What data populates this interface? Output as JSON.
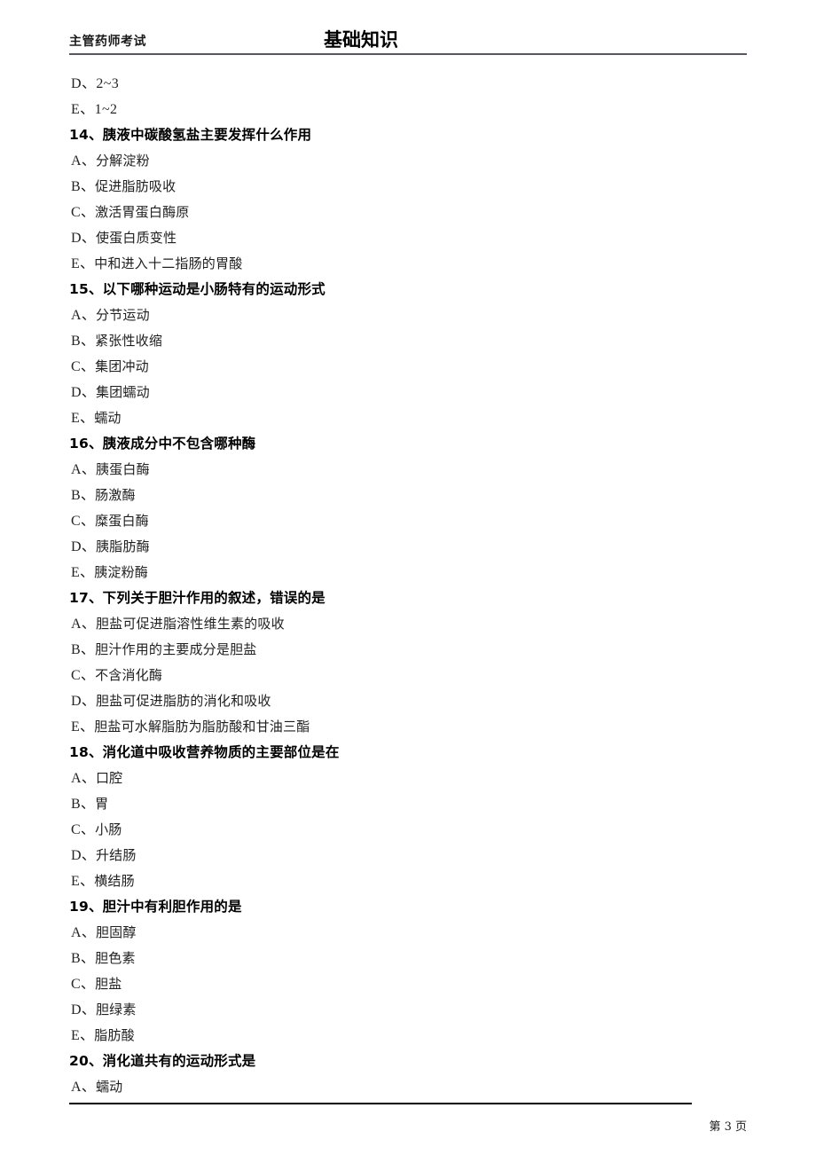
{
  "header": {
    "left_title": "主管药师考试",
    "center_title": "基础知识"
  },
  "footer": {
    "page_label": "第 3 页"
  },
  "content": {
    "leading_options": [
      {
        "letter": "D",
        "sep": "、",
        "text": "2~3"
      },
      {
        "letter": "E",
        "sep": "、",
        "text": "1~2"
      }
    ],
    "questions": [
      {
        "number": "14",
        "sep": "、",
        "title": "胰液中碳酸氢盐主要发挥什么作用",
        "options": [
          {
            "letter": "A",
            "sep": "、",
            "text": "分解淀粉"
          },
          {
            "letter": "B",
            "sep": "、",
            "text": "促进脂肪吸收"
          },
          {
            "letter": "C",
            "sep": "、",
            "text": "激活胃蛋白酶原"
          },
          {
            "letter": "D",
            "sep": "、",
            "text": "使蛋白质变性"
          },
          {
            "letter": "E",
            "sep": "、",
            "text": "中和进入十二指肠的胃酸"
          }
        ]
      },
      {
        "number": "15",
        "sep": "、",
        "title": "以下哪种运动是小肠特有的运动形式",
        "options": [
          {
            "letter": "A",
            "sep": "、",
            "text": "分节运动"
          },
          {
            "letter": "B",
            "sep": "、",
            "text": "紧张性收缩"
          },
          {
            "letter": "C",
            "sep": "、",
            "text": "集团冲动"
          },
          {
            "letter": "D",
            "sep": "、",
            "text": "集团蠕动"
          },
          {
            "letter": "E",
            "sep": "、",
            "text": "蠕动"
          }
        ]
      },
      {
        "number": "16",
        "sep": "、",
        "title": "胰液成分中不包含哪种酶",
        "options": [
          {
            "letter": "A",
            "sep": "、",
            "text": "胰蛋白酶"
          },
          {
            "letter": "B",
            "sep": "、",
            "text": "肠激酶"
          },
          {
            "letter": "C",
            "sep": "、",
            "text": "糜蛋白酶"
          },
          {
            "letter": "D",
            "sep": "、",
            "text": "胰脂肪酶"
          },
          {
            "letter": "E",
            "sep": "、",
            "text": "胰淀粉酶"
          }
        ]
      },
      {
        "number": "17",
        "sep": "、",
        "title": "下列关于胆汁作用的叙述，错误的是",
        "options": [
          {
            "letter": "A",
            "sep": "、",
            "text": "胆盐可促进脂溶性维生素的吸收"
          },
          {
            "letter": "B",
            "sep": "、",
            "text": "胆汁作用的主要成分是胆盐"
          },
          {
            "letter": "C",
            "sep": "、",
            "text": "不含消化酶"
          },
          {
            "letter": "D",
            "sep": "、",
            "text": "胆盐可促进脂肪的消化和吸收"
          },
          {
            "letter": "E",
            "sep": "、",
            "text": "胆盐可水解脂肪为脂肪酸和甘油三酯"
          }
        ]
      },
      {
        "number": "18",
        "sep": "、",
        "title": "消化道中吸收营养物质的主要部位是在",
        "options": [
          {
            "letter": "A",
            "sep": "、",
            "text": "口腔"
          },
          {
            "letter": "B",
            "sep": "、",
            "text": "胃"
          },
          {
            "letter": "C",
            "sep": "、",
            "text": "小肠"
          },
          {
            "letter": "D",
            "sep": "、",
            "text": "升结肠"
          },
          {
            "letter": "E",
            "sep": "、",
            "text": "横结肠"
          }
        ]
      },
      {
        "number": "19",
        "sep": "、",
        "title": "胆汁中有利胆作用的是",
        "options": [
          {
            "letter": "A",
            "sep": "、",
            "text": "胆固醇"
          },
          {
            "letter": "B",
            "sep": "、",
            "text": "胆色素"
          },
          {
            "letter": "C",
            "sep": "、",
            "text": "胆盐"
          },
          {
            "letter": "D",
            "sep": "、",
            "text": "胆绿素"
          },
          {
            "letter": "E",
            "sep": "、",
            "text": "脂肪酸"
          }
        ]
      },
      {
        "number": "20",
        "sep": "、",
        "title": "消化道共有的运动形式是",
        "options": [
          {
            "letter": "A",
            "sep": "、",
            "text": "蠕动"
          }
        ]
      }
    ]
  }
}
